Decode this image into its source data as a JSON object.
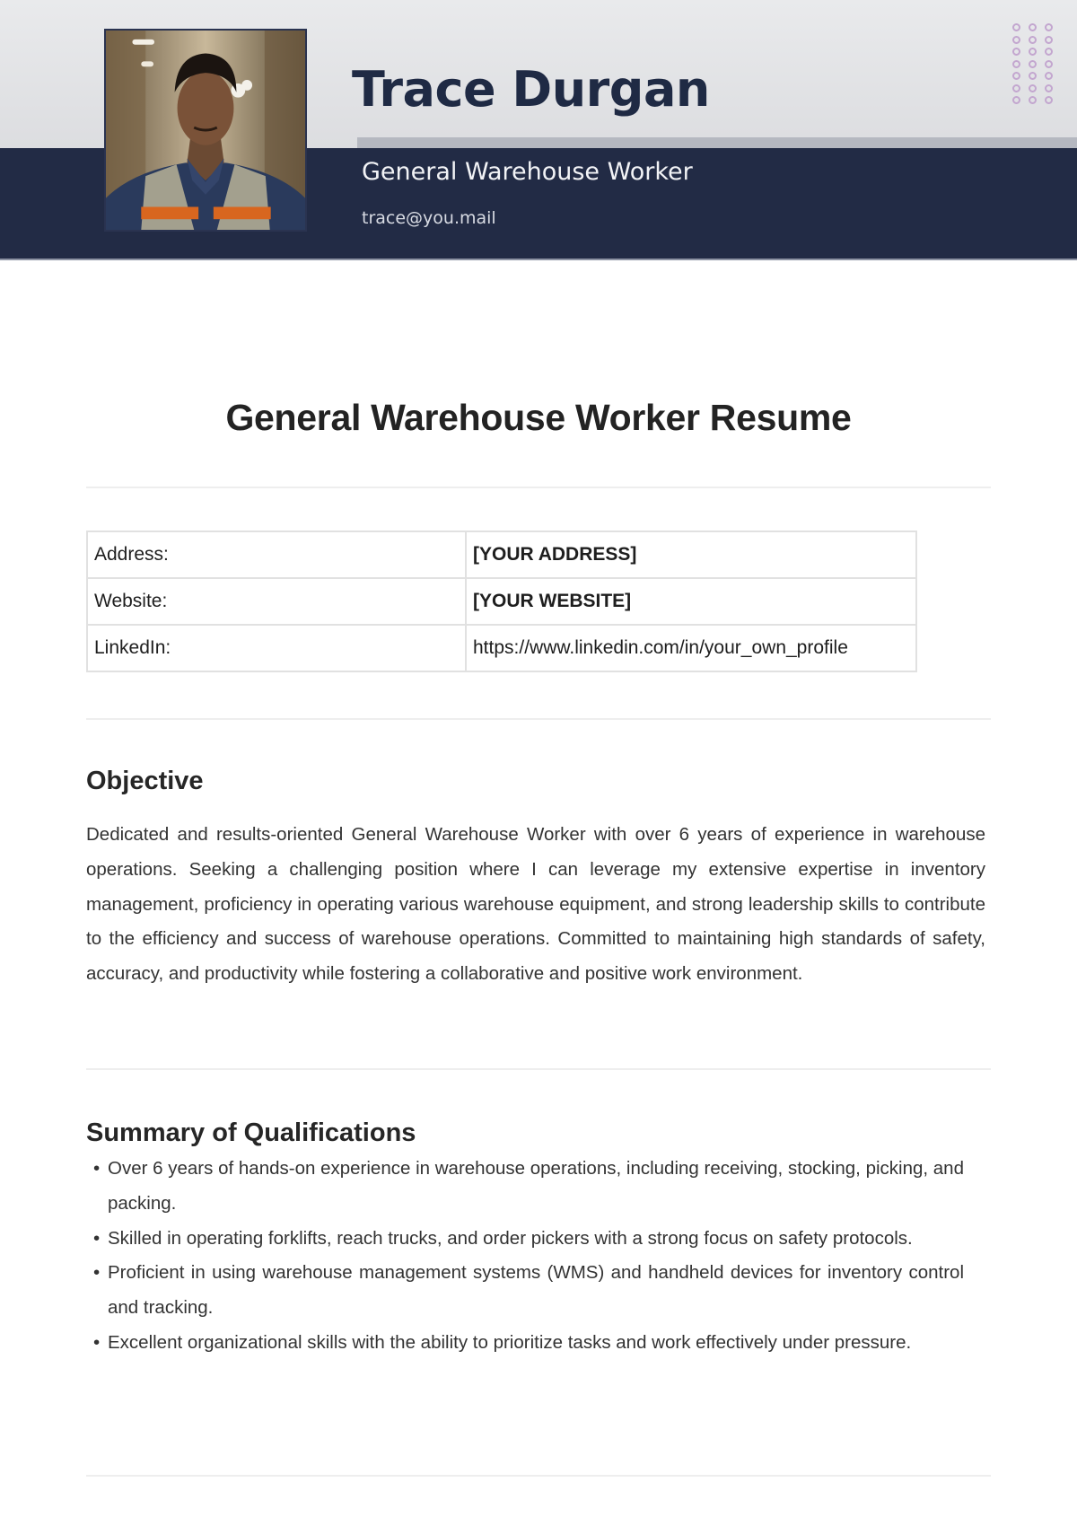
{
  "header": {
    "name": "Trace Durgan",
    "role": "General Warehouse Worker",
    "email": "trace@you.mail",
    "photo_alt": "Portrait of a warehouse worker wearing a safety vest",
    "colors": {
      "navy": "#222b45",
      "name_text": "#1f2a44",
      "light_band": "#e4e5e8",
      "accent_strip": "#b5b8c0",
      "dot_pattern": "#c3a6cf"
    }
  },
  "document": {
    "title": "General Warehouse Worker Resume"
  },
  "contact_table": {
    "rows": [
      {
        "label": "Address:",
        "value": "[YOUR ADDRESS]",
        "bold": true
      },
      {
        "label": "Website:",
        "value": "[YOUR WEBSITE]",
        "bold": true
      },
      {
        "label": "LinkedIn:",
        "value": "https://www.linkedin.com/in/your_own_profile",
        "bold": false
      }
    ]
  },
  "objective": {
    "heading": "Objective",
    "text": "Dedicated and results-oriented General Warehouse Worker with over 6 years of experience in warehouse operations. Seeking a challenging position where I can leverage my extensive expertise in inventory management, proficiency in operating various warehouse equipment, and strong leadership skills to contribute to the efficiency and success of warehouse operations. Committed to maintaining high standards of safety, accuracy, and productivity while fostering a collaborative and positive work environment."
  },
  "qualifications": {
    "heading": "Summary of Qualifications",
    "bullet": "•",
    "items": [
      "Over 6 years of hands-on experience in warehouse operations, including receiving, stocking, picking, and packing.",
      "Skilled in operating forklifts, reach trucks, and order pickers with a strong focus on safety protocols.",
      "Proficient in using warehouse management systems (WMS) and handheld devices for inventory control and tracking.",
      "Excellent organizational skills with the ability to prioritize tasks and work effectively under pressure."
    ]
  }
}
